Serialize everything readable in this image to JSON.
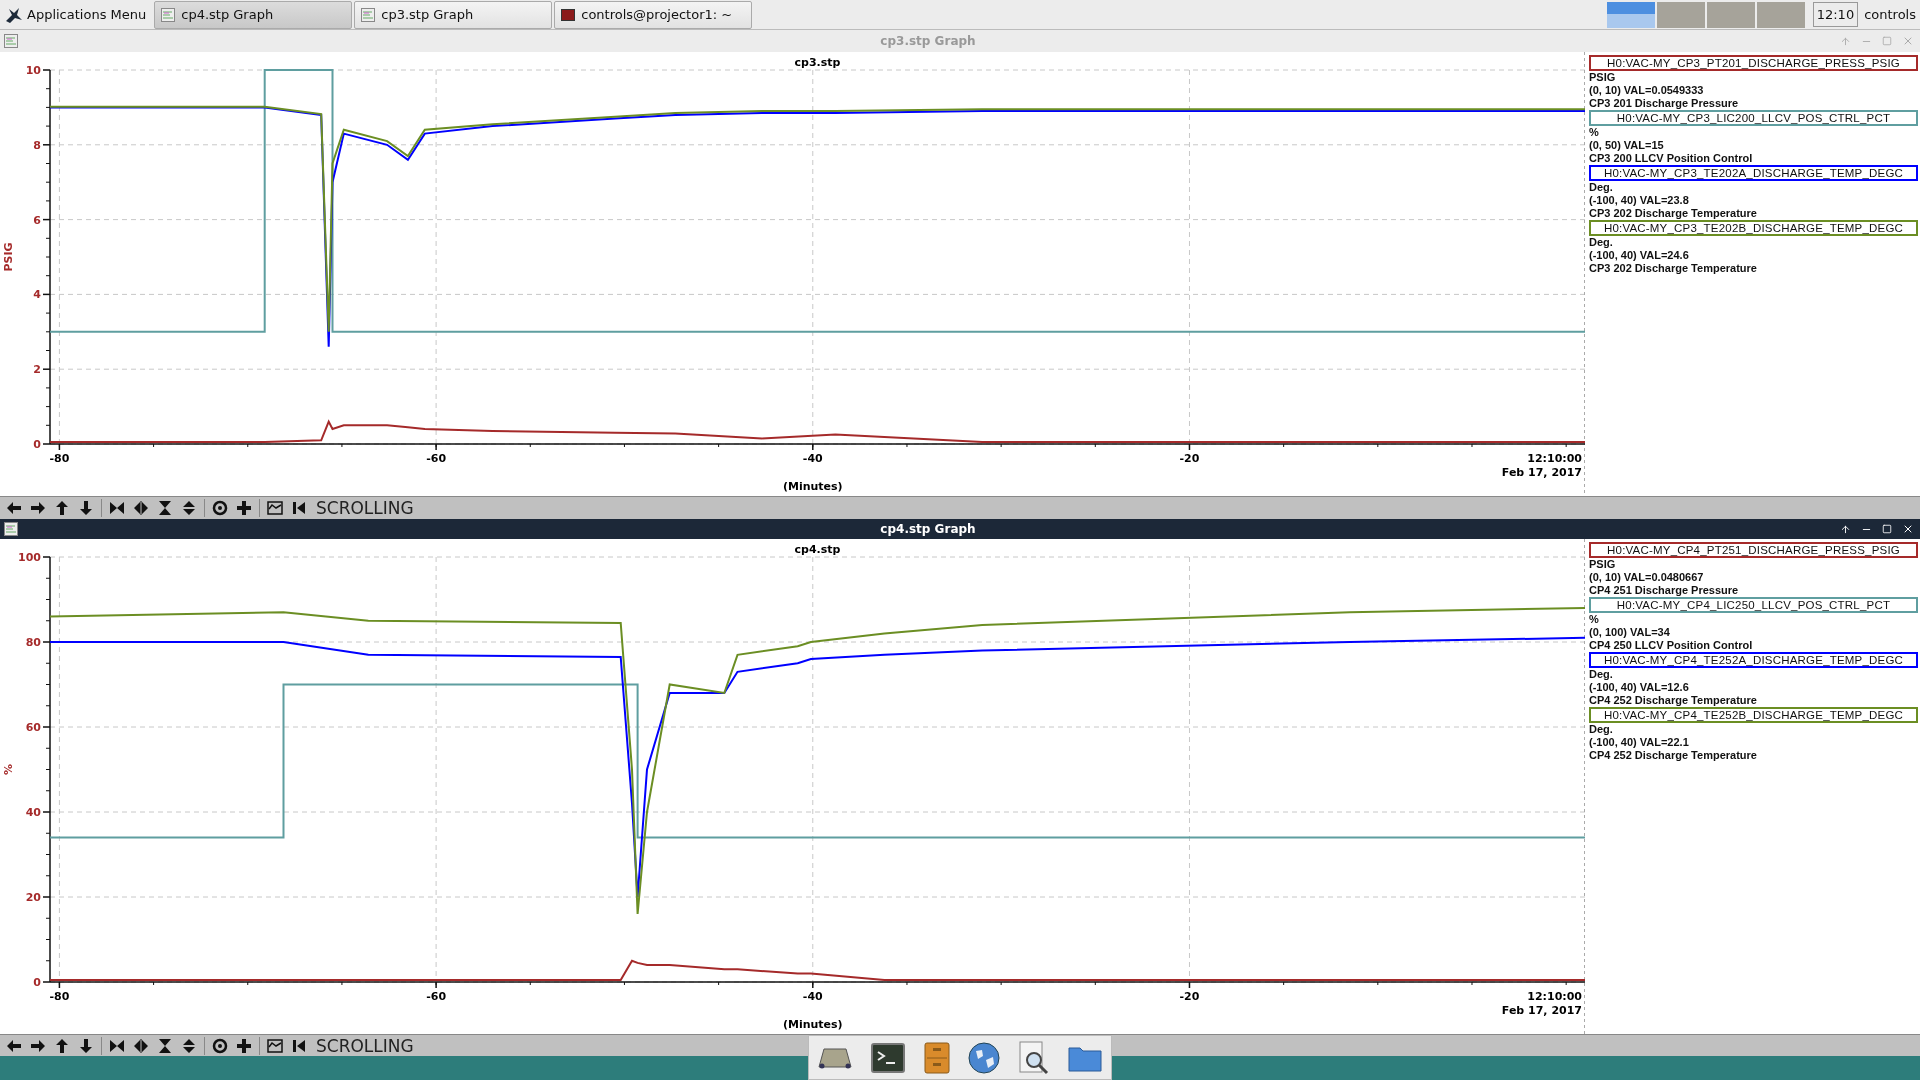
{
  "taskbar": {
    "menu_label": "Applications Menu",
    "tasks": [
      {
        "label": "cp4.stp Graph",
        "kind": "graph",
        "selected": true
      },
      {
        "label": "cp3.stp Graph",
        "kind": "graph",
        "selected": false
      },
      {
        "label": "controls@projector1: ~",
        "kind": "terminal",
        "selected": false
      }
    ],
    "workspaces": [
      {
        "selected": true
      },
      {
        "selected": false
      },
      {
        "selected": false
      },
      {
        "selected": false
      }
    ],
    "clock": "12:10",
    "user": "controls"
  },
  "windows": [
    {
      "title": "cp3.stp Graph",
      "focused": false,
      "end_time": "12:10:00",
      "end_date": "Feb 17, 2017",
      "mode": "SCROLLING",
      "legend": [
        {
          "unit": "PSIG",
          "range_value": "(0, 10) VAL=0.0549333",
          "description": "CP3 201 Discharge Pressure"
        },
        {
          "unit": "%",
          "range_value": "(0, 50) VAL=15",
          "description": "CP3 200 LLCV Position Control"
        },
        {
          "unit": "Deg.",
          "range_value": "(-100, 40) VAL=23.8",
          "description": "CP3 202 Discharge Temperature"
        },
        {
          "unit": "Deg.",
          "range_value": "(-100, 40) VAL=24.6",
          "description": "CP3 202 Discharge Temperature"
        }
      ],
      "chart_data": {
        "type": "line",
        "grid": true,
        "title": "cp3.stp",
        "xlabel": "(Minutes)",
        "ylabel": "PSIG",
        "xlim": [
          -80.5,
          1
        ],
        "ylim": [
          0,
          10
        ],
        "xticks": [
          -80,
          -60,
          -40,
          -20
        ],
        "yticks": [
          0,
          2,
          4,
          6,
          8,
          10
        ],
        "x": [
          -80.5,
          -69.1,
          -69.1,
          -66.1,
          -65.7,
          -65.5,
          -65.5,
          -64.9,
          -62.6,
          -61.5,
          -60.6,
          -57,
          -50.5,
          -47.3,
          -42.7,
          -38.8,
          -31,
          -24.5,
          1
        ],
        "series": [
          {
            "name": "H0:VAC-MY_CP3_PT201_DISCHARGE_PRESS_PSIG",
            "color": "#a52a2a",
            "values": [
              0.05,
              0.05,
              0.05,
              0.1,
              0.6,
              0.4,
              0.4,
              0.5,
              0.5,
              0.45,
              0.4,
              0.35,
              0.3,
              0.28,
              0.15,
              0.25,
              0.05,
              0.05,
              0.05
            ]
          },
          {
            "name": "H0:VAC-MY_CP3_LIC200_LLCV_POS_CTRL_PCT",
            "color": "#5f9ea0",
            "values": [
              3,
              3,
              10,
              10,
              10,
              10,
              3,
              3,
              3,
              3,
              3,
              3,
              3,
              3,
              3,
              3,
              3,
              3,
              3
            ]
          },
          {
            "name": "H0:VAC-MY_CP3_TE202A_DISCHARGE_TEMP_DEGC",
            "color": "#0000ff",
            "values": [
              9,
              9,
              9,
              8.8,
              2.6,
              7,
              7,
              8.3,
              8,
              7.6,
              8.3,
              8.5,
              8.7,
              8.8,
              8.85,
              8.85,
              8.9,
              8.9,
              8.9
            ]
          },
          {
            "name": "H0:VAC-MY_CP3_TE202B_DISCHARGE_TEMP_DEGC",
            "color": "#6b8e23",
            "values": [
              9.02,
              9.02,
              9.02,
              8.82,
              3,
              7.5,
              7.5,
              8.4,
              8.1,
              7.7,
              8.4,
              8.55,
              8.75,
              8.85,
              8.9,
              8.9,
              8.95,
              8.95,
              8.95
            ]
          }
        ]
      }
    },
    {
      "title": "cp4.stp Graph",
      "focused": true,
      "end_time": "12:10:00",
      "end_date": "Feb 17, 2017",
      "mode": "SCROLLING",
      "legend": [
        {
          "unit": "PSIG",
          "range_value": "(0, 10) VAL=0.0480667",
          "description": "CP4 251 Discharge Pressure"
        },
        {
          "unit": "%",
          "range_value": "(0, 100) VAL=34",
          "description": "CP4 250 LLCV Position Control"
        },
        {
          "unit": "Deg.",
          "range_value": "(-100, 40) VAL=12.6",
          "description": "CP4 252 Discharge Temperature"
        },
        {
          "unit": "Deg.",
          "range_value": "(-100, 40) VAL=22.1",
          "description": "CP4 252 Discharge Temperature"
        }
      ],
      "chart_data": {
        "type": "line",
        "grid": true,
        "title": "cp4.stp",
        "xlabel": "(Minutes)",
        "ylabel": "%",
        "xlim": [
          -80.5,
          1
        ],
        "ylim": [
          0,
          100
        ],
        "xticks": [
          -80,
          -60,
          -40,
          -20
        ],
        "yticks": [
          0,
          20,
          40,
          60,
          80,
          100
        ],
        "x": [
          -80.5,
          -68.1,
          -68.1,
          -63.6,
          -50.2,
          -49.6,
          -49.3,
          -49.3,
          -48.8,
          -47.6,
          -44.7,
          -44,
          -40.8,
          -40.1,
          -36.2,
          -31,
          -11.5,
          1
        ],
        "series": [
          {
            "name": "H0:VAC-MY_CP4_PT251_DISCHARGE_PRESS_PSIG",
            "color": "#a52a2a",
            "values": [
              0.5,
              0.5,
              0.5,
              0.5,
              0.5,
              5,
              4.5,
              4.5,
              4,
              4,
              3,
              3,
              2,
              2,
              0.5,
              0.5,
              0.5,
              0.5
            ]
          },
          {
            "name": "H0:VAC-MY_CP4_LIC250_LLCV_POS_CTRL_PCT",
            "color": "#5f9ea0",
            "values": [
              34,
              34,
              70,
              70,
              70,
              70,
              70,
              34,
              34,
              34,
              34,
              34,
              34,
              34,
              34,
              34,
              34,
              34
            ]
          },
          {
            "name": "H0:VAC-MY_CP4_TE252A_DISCHARGE_TEMP_DEGC",
            "color": "#0000ff",
            "values": [
              80,
              80,
              80,
              77,
              76.5,
              42,
              20,
              20,
              50,
              68,
              68,
              73,
              75,
              76,
              77,
              78,
              80,
              81
            ]
          },
          {
            "name": "H0:VAC-MY_CP4_TE252B_DISCHARGE_TEMP_DEGC",
            "color": "#6b8e23",
            "values": [
              86,
              87,
              87,
              85,
              84.5,
              50,
              16,
              16,
              40,
              70,
              68,
              77,
              79,
              80,
              82,
              84,
              87,
              88
            ]
          }
        ]
      }
    }
  ]
}
